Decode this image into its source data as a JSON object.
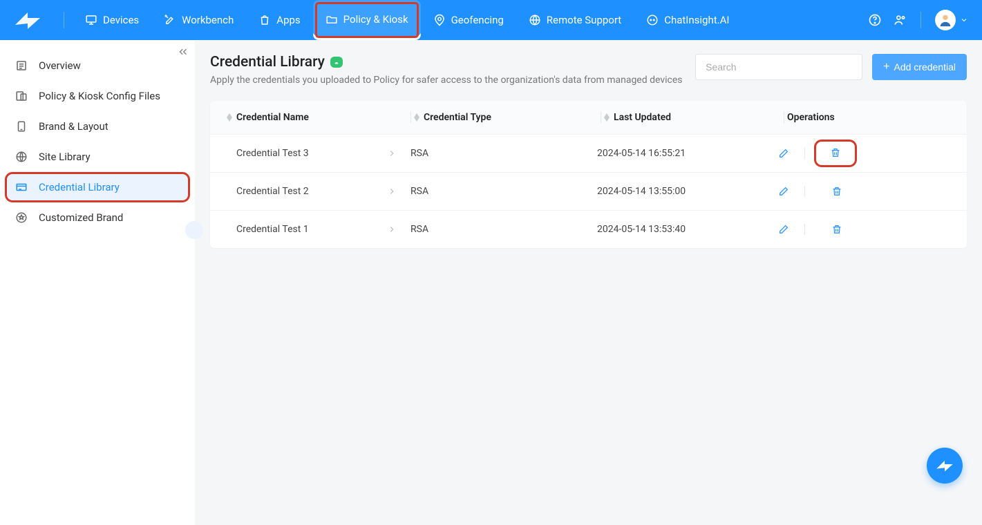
{
  "header": {
    "nav": [
      {
        "label": "Devices"
      },
      {
        "label": "Workbench"
      },
      {
        "label": "Apps"
      },
      {
        "label": "Policy & Kiosk"
      },
      {
        "label": "Geofencing"
      },
      {
        "label": "Remote Support"
      },
      {
        "label": "ChatInsight.AI"
      }
    ]
  },
  "sidebar": {
    "items": [
      {
        "label": "Overview"
      },
      {
        "label": "Policy & Kiosk Config Files"
      },
      {
        "label": "Brand & Layout"
      },
      {
        "label": "Site Library"
      },
      {
        "label": "Credential Library"
      },
      {
        "label": "Customized Brand"
      }
    ]
  },
  "page": {
    "title": "Credential Library",
    "subtitle": "Apply the credentials you uploaded to Policy for safer access to the organization's data from managed devices",
    "search_placeholder": "Search",
    "add_label": "Add credential"
  },
  "table": {
    "columns": {
      "name": "Credential Name",
      "type": "Credential Type",
      "updated": "Last Updated",
      "ops": "Operations"
    },
    "rows": [
      {
        "name": "Credential Test 3",
        "type": "RSA",
        "updated": "2024-05-14 16:55:21"
      },
      {
        "name": "Credential Test 2",
        "type": "RSA",
        "updated": "2024-05-14 13:55:00"
      },
      {
        "name": "Credential Test 1",
        "type": "RSA",
        "updated": "2024-05-14 13:53:40"
      }
    ]
  }
}
